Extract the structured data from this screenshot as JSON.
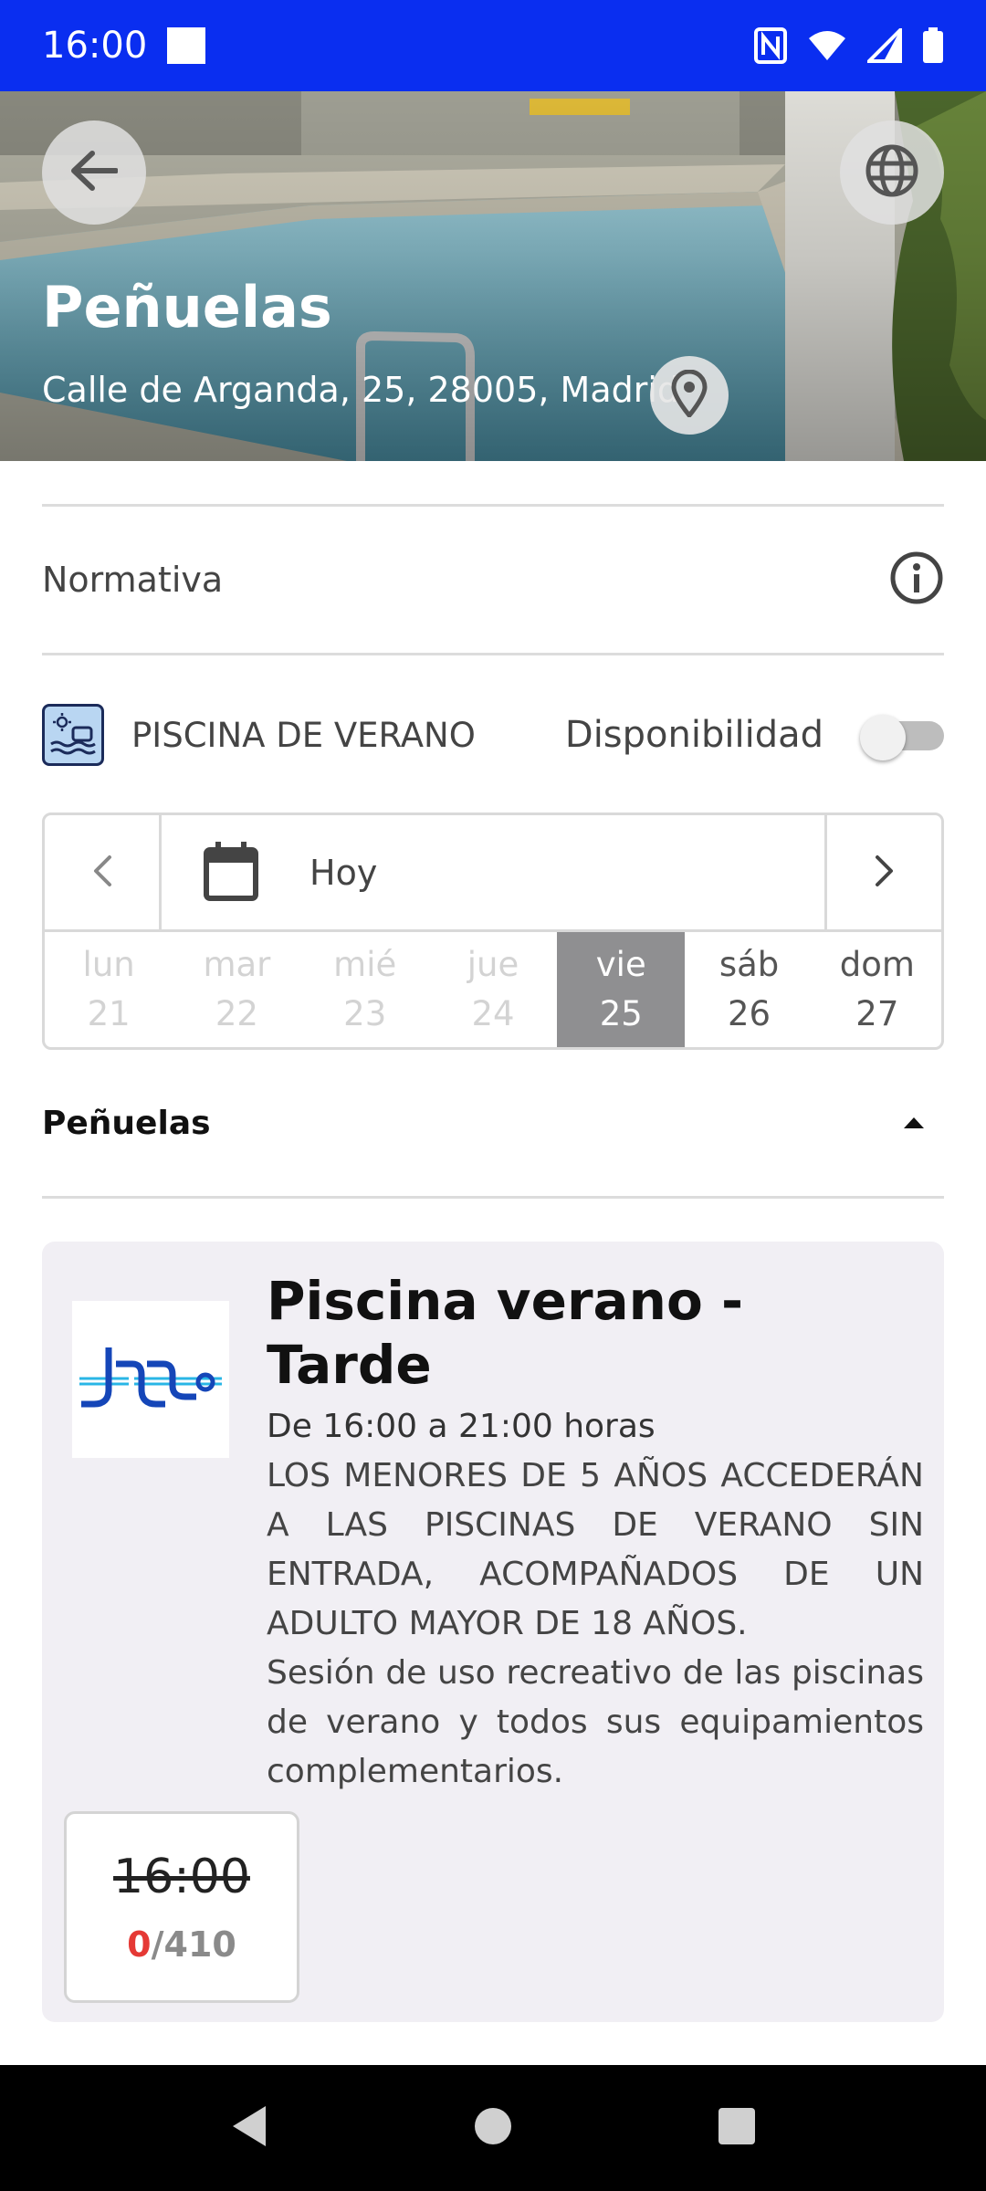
{
  "status_bar": {
    "time": "16:00",
    "icons": [
      "notification-square-icon",
      "nfc-icon",
      "wifi-icon",
      "cell-signal-icon",
      "battery-icon"
    ]
  },
  "hero": {
    "title": "Peñuelas",
    "address": "Calle de Arganda, 25, 28005, Madrid",
    "icons": [
      "back-arrow-icon",
      "globe-icon",
      "location-pin-icon"
    ]
  },
  "normativa": {
    "label": "Normativa",
    "icon": "info-icon"
  },
  "facility": {
    "type_label": "PISCINA DE VERANO",
    "availability_label": "Disponibilidad",
    "availability_on": false,
    "icon": "swimming-pool-icon"
  },
  "date_picker": {
    "today_label": "Hoy",
    "days": [
      {
        "name": "lun",
        "number": "21",
        "state": "past"
      },
      {
        "name": "mar",
        "number": "22",
        "state": "past"
      },
      {
        "name": "mié",
        "number": "23",
        "state": "past"
      },
      {
        "name": "jue",
        "number": "24",
        "state": "past"
      },
      {
        "name": "vie",
        "number": "25",
        "state": "selected"
      },
      {
        "name": "sáb",
        "number": "26",
        "state": "available"
      },
      {
        "name": "dom",
        "number": "27",
        "state": "available"
      }
    ]
  },
  "section": {
    "title": "Peñuelas",
    "expanded": true
  },
  "session": {
    "title": "Piscina verano - Tarde",
    "hours": "De 16:00 a 21:00 horas",
    "description_notice": "LOS MENORES DE 5 AÑOS ACCEDERÁN A LAS PISCINAS DE VERANO SIN ENTRADA, ACOMPAÑADOS DE UN ADULTO MAYOR DE 18 AÑOS.",
    "description_detail": "Sesión de uso recreativo de las piscinas de verano y todos sus equipamientos complementarios.",
    "slot": {
      "time": "16:00",
      "taken": "0",
      "separator": "/",
      "capacity": "410"
    }
  },
  "colors": {
    "status_bar": "#0a2ef0",
    "selected_day": "#8f8f91",
    "card_background": "#f1eff4",
    "taken_count": "#e53935"
  }
}
